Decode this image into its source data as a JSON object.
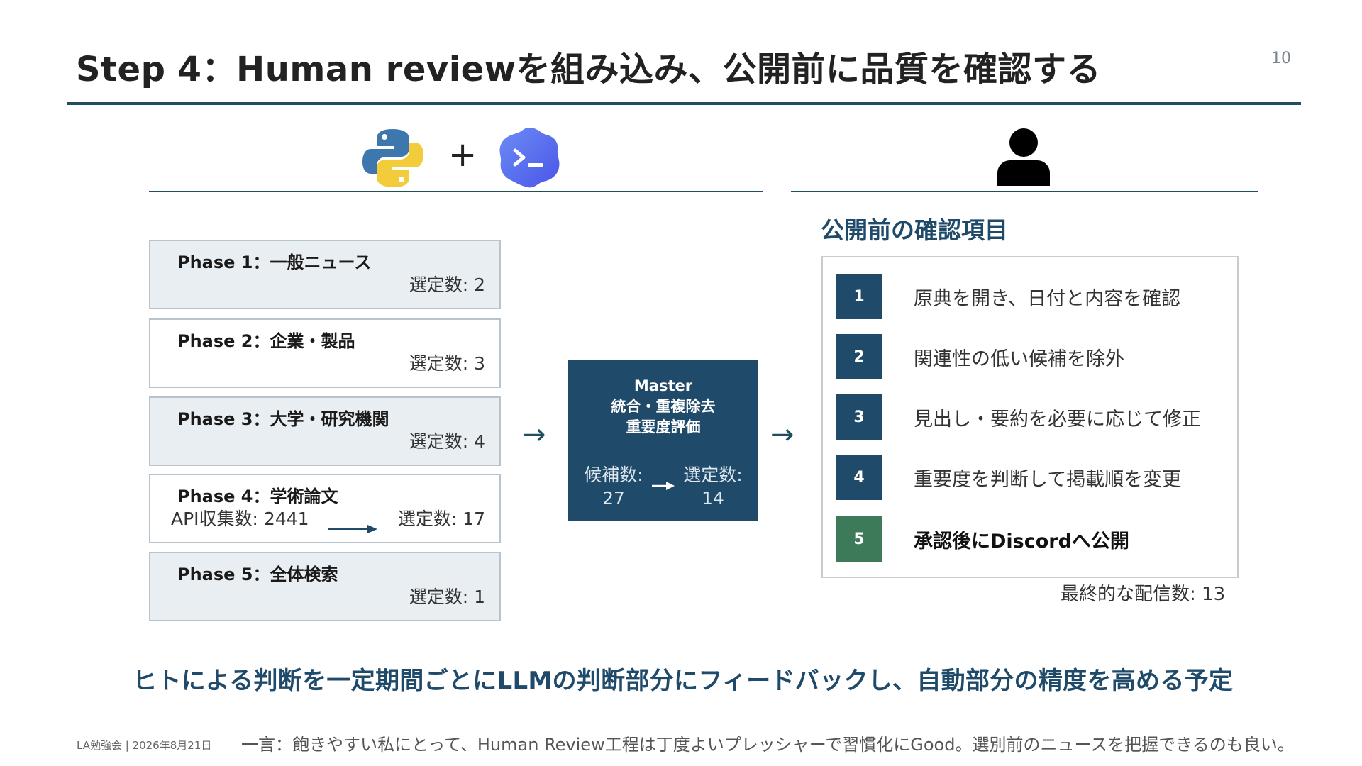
{
  "slide": {
    "title": "Step 4：Human reviewを組み込み、公開前に品質を確認する",
    "page_number": "10",
    "plus_sign": "+",
    "accent_color": "#1f4a6a",
    "green_color": "#3d7a5a"
  },
  "icons": {
    "python": "python-logo-icon",
    "terminal": "terminal-app-icon",
    "person": "person-icon"
  },
  "phases": [
    {
      "title": "Phase 1：一般ニュース",
      "selected": "選定数: 2"
    },
    {
      "title": "Phase 2：企業・製品",
      "selected": "選定数: 3"
    },
    {
      "title": "Phase 3：大学・研究機関",
      "selected": "選定数: 4"
    },
    {
      "title": "Phase 4：学術論文",
      "api": "API収集数: 2441",
      "selected": "選定数: 17"
    },
    {
      "title": "Phase 5：全体検索",
      "selected": "選定数: 1"
    }
  ],
  "arrows": {
    "symbol": "→"
  },
  "master": {
    "line1": "Master",
    "line2": "統合・重複除去",
    "line3": "重要度評価",
    "candidates_label": "候補数:",
    "candidates_value": "27",
    "selected_label": "選定数:",
    "selected_value": "14"
  },
  "review": {
    "heading": "公開前の確認項目",
    "items": [
      {
        "num": "1",
        "text": "原典を開き、日付と内容を確認"
      },
      {
        "num": "2",
        "text": "関連性の低い候補を除外"
      },
      {
        "num": "3",
        "text": "見出し・要約を必要に応じて修正"
      },
      {
        "num": "4",
        "text": "重要度を判断して掲載順を変更"
      },
      {
        "num": "5",
        "text": "承認後にDiscordへ公開"
      }
    ],
    "final_count": "最終的な配信数: 13"
  },
  "message": "ヒトによる判断を一定期間ごとにLLMの判断部分にフィードバックし、自動部分の精度を高める予定",
  "footer": {
    "left": "LA勉強会 | 2026年8月21日",
    "comment": "一言：飽きやすい私にとって、Human Review工程は丁度よいプレッシャーで習慣化にGood。選別前のニュースを把握できるのも良い。"
  }
}
